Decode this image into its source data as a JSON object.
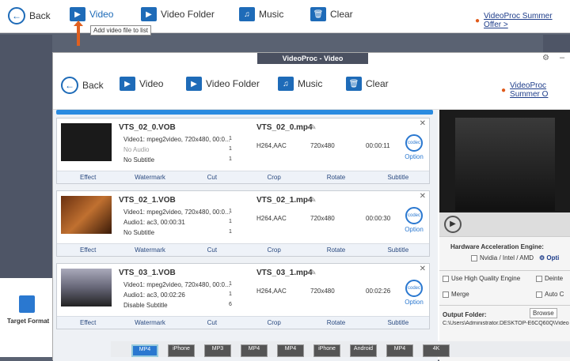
{
  "outer_toolbar": {
    "back": "Back",
    "video": "Video",
    "video_folder": "Video Folder",
    "music": "Music",
    "clear": "Clear",
    "promo": "VideoProc Summer Offer >",
    "tooltip": "Add video file to list"
  },
  "left_panel": {
    "target_format": "Target Format"
  },
  "window": {
    "title": "VideoProc - Video"
  },
  "inner_toolbar": {
    "back": "Back",
    "video": "Video",
    "video_folder": "Video Folder",
    "music": "Music",
    "clear": "Clear",
    "promo": "VideoProc Summer O"
  },
  "items": [
    {
      "name": "VTS_02_0.VOB",
      "video": "Video1: mpeg2video, 720x480, 00:0...",
      "audio": "No Audio",
      "subtitle": "No Subtitle",
      "n1": "1",
      "n2": "1",
      "n3": "1",
      "out": "VTS_02_0.mp4",
      "codec": "H264,AAC",
      "res": "720x480",
      "dur": "00:00:11",
      "option": "Option"
    },
    {
      "name": "VTS_02_1.VOB",
      "video": "Video1: mpeg2video, 720x480, 00:0...",
      "audio": "Audio1: ac3, 00:00:31",
      "subtitle": "No Subtitle",
      "n1": "1",
      "n2": "1",
      "n3": "1",
      "out": "VTS_02_1.mp4",
      "codec": "H264,AAC",
      "res": "720x480",
      "dur": "00:00:30",
      "option": "Option"
    },
    {
      "name": "VTS_03_1.VOB",
      "video": "Video1: mpeg2video, 720x480, 00:0...",
      "audio": "Audio1: ac3, 00:02:26",
      "subtitle": "Disable Subtitle",
      "n1": "1",
      "n2": "1",
      "n3": "6",
      "out": "VTS_03_1.mp4",
      "codec": "H264,AAC",
      "res": "720x480",
      "dur": "00:02:26",
      "option": "Option"
    }
  ],
  "actions": [
    "Effect",
    "Watermark",
    "Cut",
    "Crop",
    "Rotate",
    "Subtitle"
  ],
  "settings": {
    "hw_title": "Hardware Acceleration Engine:",
    "nvidia": "Nvidia / Intel / AMD",
    "opt": "Opti",
    "hq": "Use High Quality Engine",
    "deinterlace": "Deinte",
    "merge": "Merge",
    "autocopy": "Auto C",
    "output_folder": "Output Folder:",
    "browse": "Browse",
    "path": "C:\\Users\\Administrator.DESKTOP-E6CQ60Q\\Videos"
  },
  "formats": [
    "MP4",
    "iPhone",
    "MP3",
    "MP4",
    "MP4",
    "iPhone",
    "Android",
    "MP4",
    "4K"
  ]
}
